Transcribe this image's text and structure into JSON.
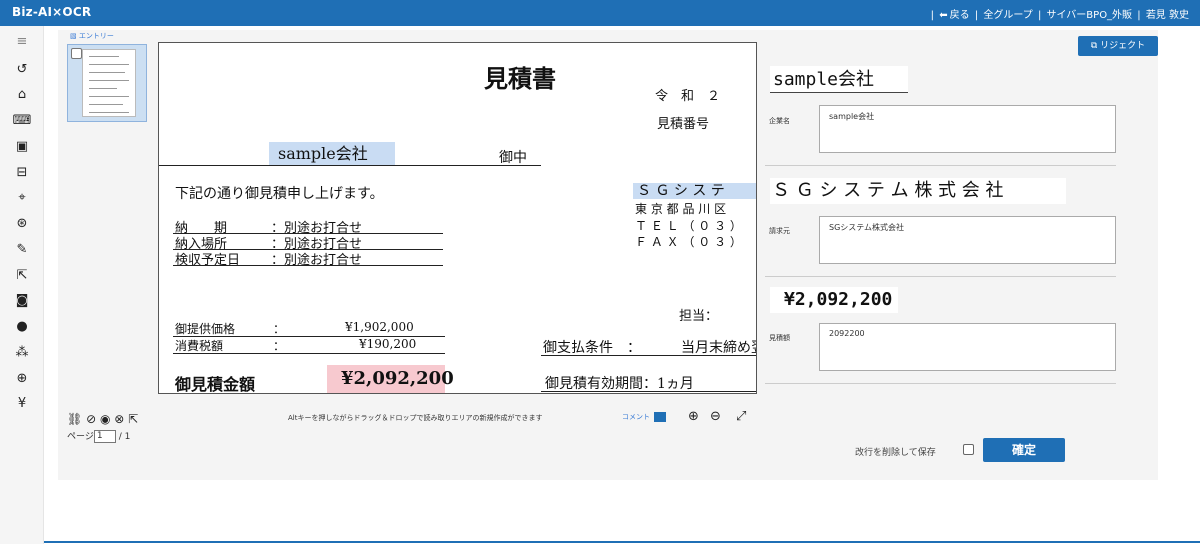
{
  "app": {
    "brand": "Biz-AI×OCR"
  },
  "topnav": {
    "back": "戻る",
    "group": "全グループ",
    "org": "サイバーBPO_外販",
    "user": "若見 敦史",
    "sep": "|"
  },
  "sidebar": {
    "icons": [
      "menu-icon",
      "headset-icon",
      "binoculars-icon",
      "keyboard-settings-icon",
      "window-icon",
      "layout-icon",
      "scan-icon",
      "image-settings-icon",
      "edit-check-icon",
      "export-icon",
      "alert-box-icon",
      "user-icon",
      "users-icon",
      "globe-icon",
      "yen-icon"
    ],
    "glyphs": [
      "≡",
      "↺",
      "⌂",
      "⌨",
      "▣",
      "⊟",
      "⌖",
      "⊛",
      "✎",
      "⇱",
      "◙",
      "●",
      "⁂",
      "⊕",
      "¥"
    ]
  },
  "viewer": {
    "entry_label": "エントリー",
    "page_label": "ページ",
    "page_value": "1",
    "page_total": "/ 1",
    "hint": "Altキーを押しながらドラッグ＆ドロップで読み取りエリアの新規作成ができます",
    "comment": "コメント",
    "tool_glyphs": [
      "⛓",
      "⊘",
      "◉",
      "⊗",
      "⇱"
    ],
    "zoom_in": "⊕",
    "zoom_out": "⊖",
    "fit": "⤢"
  },
  "document": {
    "title": "見積書",
    "era": "令　和　２",
    "est_no_label": "見積番号",
    "client": "sample会社",
    "honorific": "御中",
    "intro": "下記の通り御見積申し上げます。",
    "terms": [
      {
        "label": "納　　期",
        "value": "：別途お打合せ"
      },
      {
        "label": "納入場所",
        "value": "：別途お打合せ"
      },
      {
        "label": "検収予定日",
        "value": "：別途お打合せ"
      }
    ],
    "issuer_name": "Ｓ Ｇ シ ス テ",
    "issuer_addr": "東 京 都 品 川 区",
    "tel": "Ｔ Ｅ Ｌ （ ０ ３ ）",
    "fax": "Ｆ Ａ Ｘ （ ０ ３ ）",
    "staff": "担当：",
    "price_label": "御提供価格",
    "price_colon": "：",
    "price_value": "¥1,902,000",
    "tax_label": "消費税額",
    "tax_colon": "：",
    "tax_value": "¥190,200",
    "payment_label": "御支払条件　：",
    "payment_value": "当月末締め翌",
    "total_label": "御見積金額",
    "total_value": "¥2,092,200",
    "validity": "御見積有効期間：1ヵ月"
  },
  "form": {
    "reject_label": "リジェクト",
    "fields": [
      {
        "label": "企業名",
        "image_text": "sample会社",
        "value": "sample会社"
      },
      {
        "label": "請求元",
        "image_text": "Ｓ Ｇ シ ス テ ム 株 式 会 社",
        "value": "SGシステム株式会社"
      },
      {
        "label": "見積額",
        "image_text": "¥2,092,200",
        "value": "2092200"
      }
    ],
    "save_without_newline": "改行を削除して保存",
    "confirm_label": "確定"
  },
  "colors": {
    "header": "#1f6fb5",
    "highlight_blue": "#c9dcf3",
    "highlight_pink": "#f7c9cf"
  }
}
